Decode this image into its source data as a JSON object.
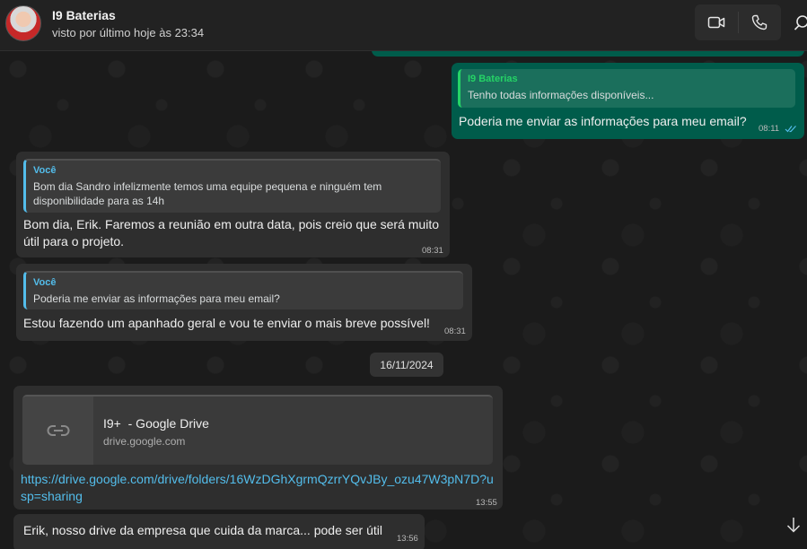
{
  "header": {
    "contact_name": "I9 Baterias",
    "last_seen": "visto por último hoje às 23:34",
    "icons": {
      "avatar": "avatar",
      "video": "video-call-icon",
      "voice": "voice-call-icon",
      "search": "search-icon"
    }
  },
  "messages": [
    {
      "direction": "outgoing",
      "quote_author": "I9 Baterias",
      "quote_text": "Tenho todas informações disponíveis...",
      "text": "Poderia me enviar as informações para meu email?",
      "time": "08:11",
      "status": "read"
    },
    {
      "direction": "incoming",
      "quote_author": "Você",
      "quote_text": "Bom dia Sandro infelizmente temos uma equipe pequena e ninguém tem disponibilidade para as 14h",
      "text": "Bom dia, Erik. Faremos a reunião em outra data, pois creio que será muito útil para o projeto.",
      "time": "08:31"
    },
    {
      "direction": "incoming",
      "quote_author": "Você",
      "quote_text": "Poderia me enviar as informações para meu email?",
      "text": "Estou fazendo um apanhado geral e vou te enviar o mais breve possível!",
      "time": "08:31"
    },
    {
      "direction": "incoming",
      "link_title": "I9+  - Google Drive",
      "link_domain": "drive.google.com",
      "link_url": "https://drive.google.com/drive/folders/16WzDGhXgrmQzrrYQvJBy_ozu47W3pN7D?usp=sharing",
      "time": "13:55"
    },
    {
      "direction": "incoming",
      "text": "Erik, nosso drive da empresa que cuida da marca... pode ser útil",
      "time": "13:56"
    }
  ],
  "date_separator": "16/11/2024",
  "colors": {
    "outgoing_bubble": "#005c4b",
    "incoming_bubble": "#2e2e2e",
    "link": "#53bdeb",
    "read_ticks": "#53bdeb"
  }
}
